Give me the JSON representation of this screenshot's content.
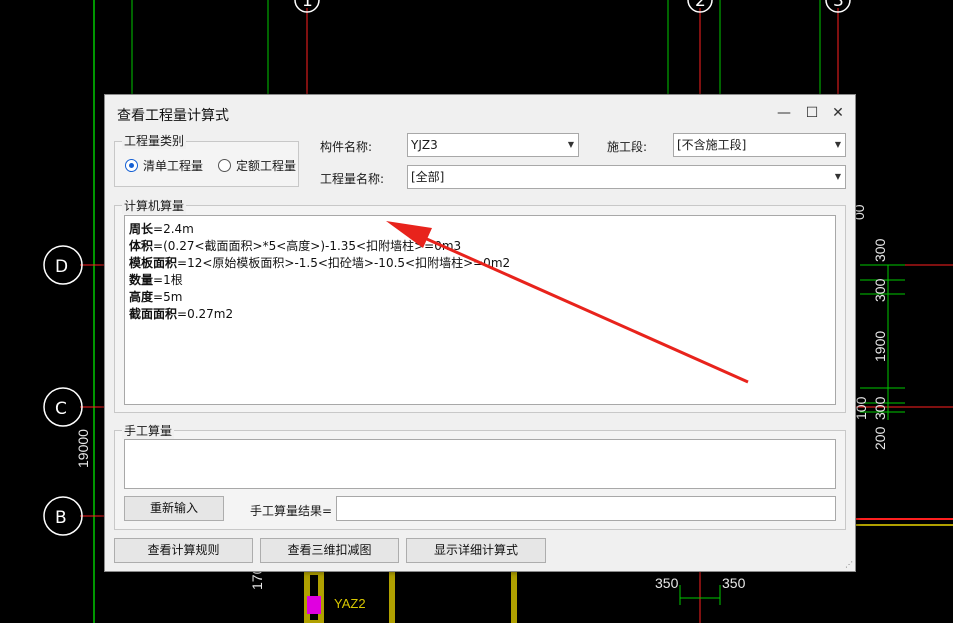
{
  "cad": {
    "axis_numbers": [
      "1",
      "2",
      "3"
    ],
    "axis_letters": [
      "D",
      "C",
      "B"
    ],
    "dims_right": [
      "300",
      "300",
      "1900",
      "300",
      "100",
      "200"
    ],
    "dim_left": "19000",
    "dims_bottom": [
      "350",
      "350"
    ],
    "dim_170": "170",
    "dim_00": "00",
    "column_label": "YAZ2"
  },
  "dialog": {
    "title": "查看工程量计算式",
    "quantity_type": {
      "legend": "工程量类别",
      "options": [
        "清单工程量",
        "定额工程量"
      ],
      "selected": "清单工程量"
    },
    "component_name": {
      "label": "构件名称:",
      "value": "YJZ3"
    },
    "construction_stage": {
      "label": "施工段:",
      "value": "[不含施工段]"
    },
    "quantity_name": {
      "label": "工程量名称:",
      "value": "[全部]"
    },
    "computer_calc": {
      "legend": "计算机算量",
      "lines": [
        {
          "name": "周长",
          "expr": "=2.4m"
        },
        {
          "name": "体积",
          "expr": "=(0.27<截面面积>*5<高度>)-1.35<扣附墙柱>=0m3"
        },
        {
          "name": "模板面积",
          "expr": "=12<原始模板面积>-1.5<扣砼墙>-10.5<扣附墙柱>=0m2"
        },
        {
          "name": "数量",
          "expr": "=1根"
        },
        {
          "name": "高度",
          "expr": "=5m"
        },
        {
          "name": "截面面积",
          "expr": "=0.27m2"
        }
      ]
    },
    "manual_calc": {
      "legend": "手工算量",
      "reenter_label": "重新输入",
      "result_label": "手工算量结果="
    },
    "buttons": {
      "view_rules": "查看计算规则",
      "view_3d": "查看三维扣减图",
      "show_detail": "显示详细计算式"
    },
    "icons": {
      "minimize": "minimize-icon",
      "maximize": "maximize-icon",
      "close": "close-icon"
    }
  },
  "colors": {
    "annotation_arrow": "#e8231c",
    "grid_line_green": "#00c800",
    "grid_line_red": "#ff2020",
    "accent_radio": "#1560d4"
  }
}
